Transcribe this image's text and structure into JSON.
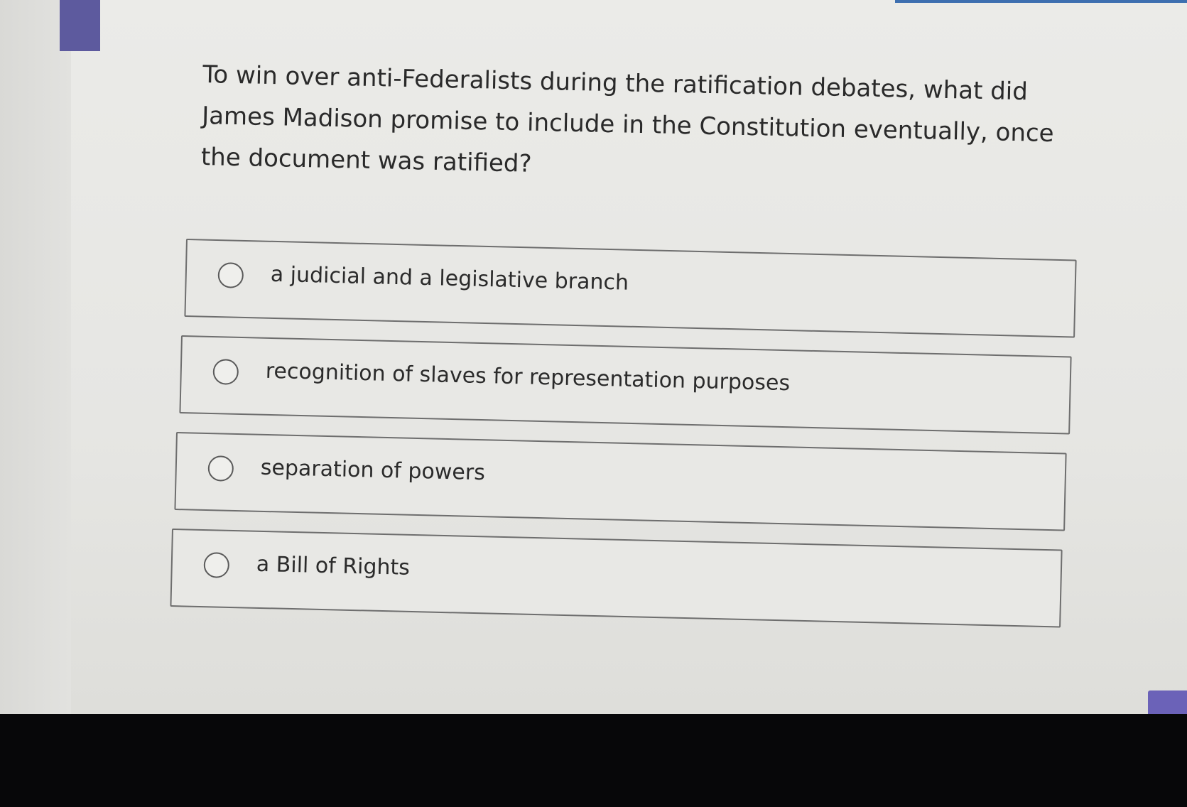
{
  "question": {
    "text": "To win over anti-Federalists during the ratification debates, what did James Madison promise to include in the Constitution eventually, once the document was ratified?"
  },
  "options": [
    {
      "label": "a judicial and a legislative branch",
      "selected": false
    },
    {
      "label": "recognition of slaves for representation purposes",
      "selected": false
    },
    {
      "label": "separation of powers",
      "selected": false
    },
    {
      "label": "a Bill of Rights",
      "selected": false
    }
  ],
  "colors": {
    "accent": "#5d5a9e",
    "button": "#6b62b8",
    "top_rule": "#3d6fb0"
  }
}
